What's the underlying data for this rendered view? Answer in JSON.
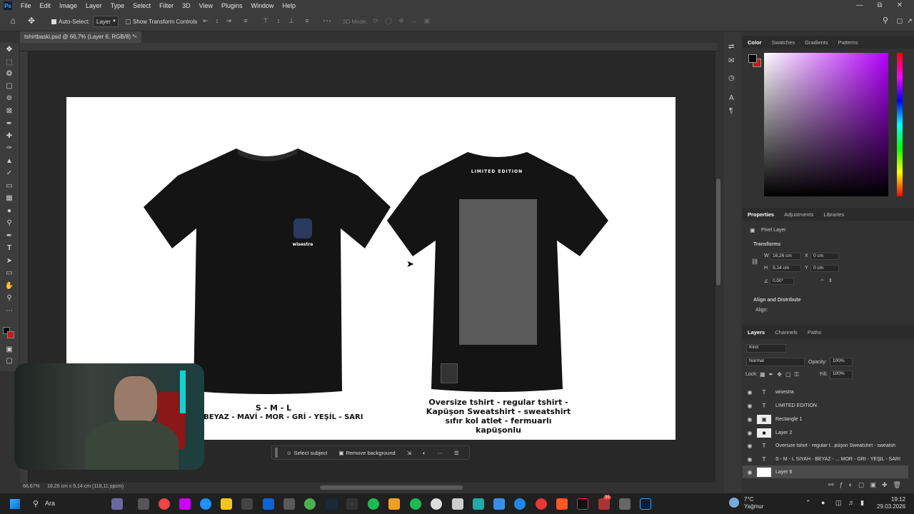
{
  "menu": {
    "items": [
      "File",
      "Edit",
      "Image",
      "Layer",
      "Type",
      "Select",
      "Filter",
      "3D",
      "View",
      "Plugins",
      "Window",
      "Help"
    ]
  },
  "options": {
    "auto_select_label": "Auto-Select:",
    "auto_select_value": "Layer",
    "show_transform_label": "Show Transform Controls",
    "mode_3d_label": "3D Mode:"
  },
  "document": {
    "tab_title": "tshirtbaski.psd @ 66,7% (Layer 6, RGB/8) *"
  },
  "canvas": {
    "left_shirt_logo_text": "wisestra",
    "left_shirt_sizes": "S - M - L",
    "left_shirt_colors": "- BEYAZ - MAVİ - MOR - GRİ - YEŞİL - SARI",
    "right_shirt_print": "LIMITED EDITION",
    "right_shirt_desc_1": "Oversize tshirt - regular tshirt -",
    "right_shirt_desc_2": "Kapüşon Sweatshirt - sweatshirt -",
    "right_shirt_desc_3": "sıfır kol atlet - fermuarlı kapüşonlu"
  },
  "context_bar": {
    "select_subject": "Select subject",
    "remove_background": "Remove background"
  },
  "status": {
    "zoom": "66,67%",
    "doc_size": "16,26 cm x 9,14 cm (118,11 ppcm)"
  },
  "color_panel": {
    "tabs": [
      "Color",
      "Swatches",
      "Gradients",
      "Patterns"
    ],
    "foreground": "#000000",
    "background": "#c41a1a",
    "hue_color": "#b400ff"
  },
  "properties_panel": {
    "tabs": [
      "Properties",
      "Adjustments",
      "Libraries"
    ],
    "layer_type": "Pixel Layer",
    "transform_title": "Transforms",
    "w_label": "W",
    "w_value": "16,26 cm",
    "h_label": "H",
    "h_value": "9,14 cm",
    "x_label": "X",
    "x_value": "0 cm",
    "y_label": "Y",
    "y_value": "0 cm",
    "angle_value": "0,00°",
    "align_title": "Align and Distribute",
    "align_label": "Align:"
  },
  "layers_panel": {
    "tabs": [
      "Layers",
      "Channels",
      "Paths"
    ],
    "filter_kind": "Kind",
    "blend_mode": "Normal",
    "opacity_label": "Opacity:",
    "opacity_value": "100%",
    "lock_label": "Lock:",
    "fill_label": "Fill:",
    "fill_value": "100%",
    "layers": [
      {
        "name": "wisestra",
        "type": "text"
      },
      {
        "name": "LIMITED EDITION",
        "type": "text"
      },
      {
        "name": "Rectangle 1",
        "type": "shape"
      },
      {
        "name": "Layer 2",
        "type": "pixel"
      },
      {
        "name": "Oversize tshirt - regular t...püşon Sweatshirt - sweatsh",
        "type": "text"
      },
      {
        "name": "S - M - L SİYAH - BEYAZ - ... MOR - GRİ - YEŞİL - SARI",
        "type": "text"
      },
      {
        "name": "Layer 6",
        "type": "pixel",
        "selected": true
      }
    ]
  },
  "taskbar": {
    "search_placeholder": "Ara",
    "weather_temp": "7°C",
    "weather_desc": "Yağmur",
    "time": "19:12",
    "date": "29.03.2026",
    "badge_count": "35"
  }
}
